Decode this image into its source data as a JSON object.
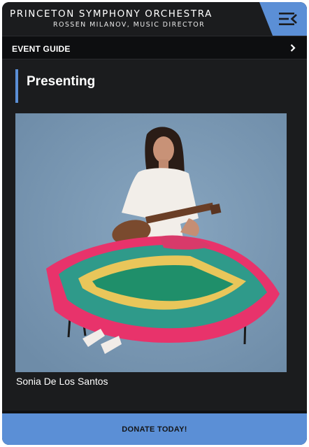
{
  "header": {
    "title": "PRINCETON SYMPHONY ORCHESTRA",
    "subtitle": "ROSSEN MILANOV, MUSIC DIRECTOR",
    "menu_icon": "menu-collapse-icon"
  },
  "event_guide": {
    "label": "EVENT GUIDE",
    "chevron_icon": "chevron-right-icon"
  },
  "main": {
    "section_title": "Presenting",
    "performer": {
      "name": "Sonia De Los Santos"
    }
  },
  "footer": {
    "donate_label": "DONATE TODAY!"
  },
  "colors": {
    "accent": "#5b8fd6",
    "background": "#1b1c1e",
    "bar": "#0d0e10",
    "photo_backdrop": "#7d9bb6"
  }
}
